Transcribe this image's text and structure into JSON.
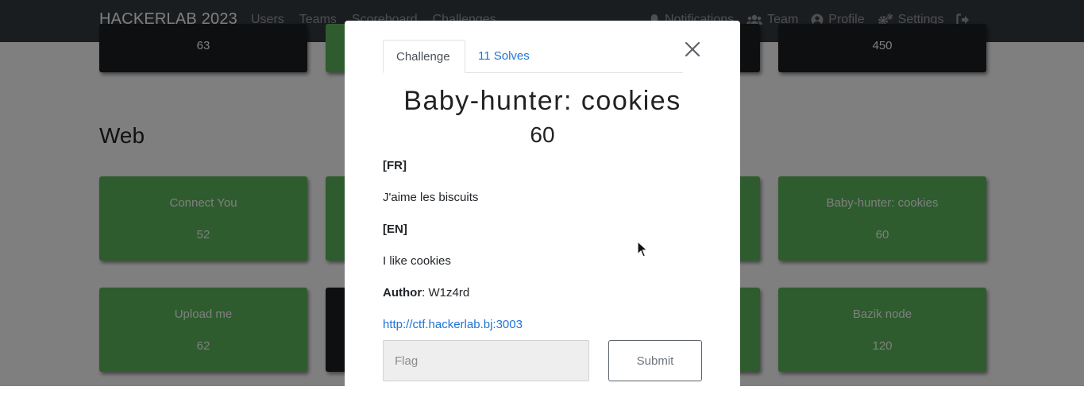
{
  "navbar": {
    "brand": "HACKERLAB 2023",
    "links": [
      "Users",
      "Teams",
      "Scoreboard",
      "Challenges"
    ],
    "right": [
      {
        "icon": "bell-icon",
        "label": "Notifications"
      },
      {
        "icon": "users-icon",
        "label": "Team"
      },
      {
        "icon": "user-circle-icon",
        "label": "Profile"
      },
      {
        "icon": "gears-icon",
        "label": "Settings"
      },
      {
        "icon": "logout-icon",
        "label": ""
      }
    ]
  },
  "board": {
    "top_row_values": [
      "63",
      "450"
    ],
    "section": "Web",
    "cards": [
      {
        "name": "Connect You",
        "value": "52",
        "status": "solved"
      },
      {
        "name": "Baby-hunter: cookies",
        "value": "60",
        "status": "solved"
      },
      {
        "name": "Upload me",
        "value": "62",
        "status": "solved"
      },
      {
        "name": "Bazik node",
        "value": "120",
        "status": "solved"
      }
    ]
  },
  "modal": {
    "tabs": {
      "challenge": "Challenge",
      "solves": "11 Solves"
    },
    "title": "Baby-hunter: cookies",
    "value": "60",
    "description": {
      "fr_heading": "[FR]",
      "fr_text": "J'aime les biscuits",
      "en_heading": "[EN]",
      "en_text": "I like cookies",
      "author_label": "Author",
      "author_sep": ": ",
      "author": "W1z4rd",
      "url": "http://ctf.hackerlab.bj:3003"
    },
    "flag_placeholder": "Flag",
    "submit_label": "Submit"
  },
  "colors": {
    "solved": "#5cb85c",
    "unsolved": "#1a1e22",
    "link": "#1e73d8",
    "navbar": "#343a40"
  }
}
